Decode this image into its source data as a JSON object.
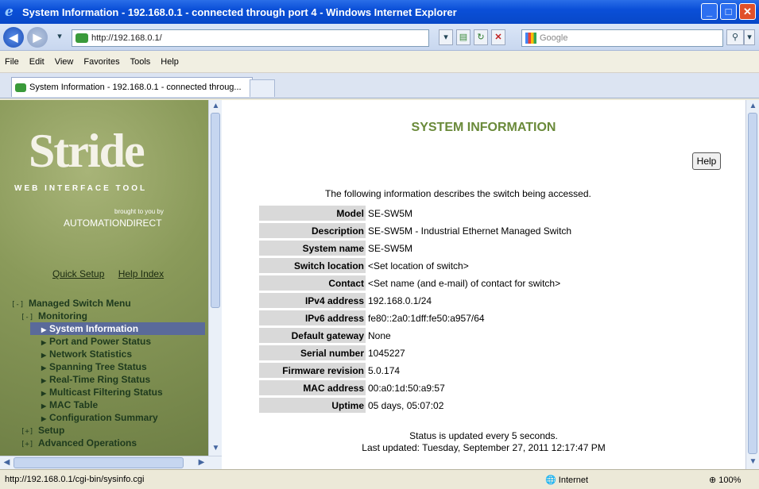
{
  "window": {
    "title": "System Information - 192.168.0.1 - connected through port 4 - Windows Internet Explorer",
    "min": "_",
    "max": "□",
    "close": "✕"
  },
  "address": {
    "url": "http://192.168.0.1/",
    "search_placeholder": "Google"
  },
  "menu": [
    "File",
    "Edit",
    "View",
    "Favorites",
    "Tools",
    "Help"
  ],
  "tab": {
    "label": "System Information - 192.168.0.1 - connected throug..."
  },
  "left": {
    "logo": "Stride",
    "logo_sub": "WEB INTERFACE TOOL",
    "brought": "brought to you by",
    "brand": "AUTOMATIONDIRECT",
    "links": [
      "Quick Setup",
      "Help Index"
    ],
    "tree": {
      "root_toggle": "[-]",
      "root": "Managed Switch Menu",
      "monitoring_toggle": "[-]",
      "monitoring": "Monitoring",
      "items": [
        "System Information",
        "Port and Power Status",
        "Network Statistics",
        "Spanning Tree Status",
        "Real-Time Ring Status",
        "Multicast Filtering Status",
        "MAC Table",
        "Configuration Summary"
      ],
      "setup_toggle": "[+]",
      "setup": "Setup",
      "adv_toggle": "[+]",
      "advanced": "Advanced Operations"
    }
  },
  "main": {
    "title": "SYSTEM INFORMATION",
    "help": "Help",
    "intro": "The following information describes the switch being accessed.",
    "rows": [
      {
        "k": "Model",
        "v": "SE-SW5M"
      },
      {
        "k": "Description",
        "v": "SE-SW5M - Industrial Ethernet Managed Switch"
      },
      {
        "k": "System name",
        "v": "SE-SW5M"
      },
      {
        "k": "Switch location",
        "v": "<Set location of switch>"
      },
      {
        "k": "Contact",
        "v": "<Set name (and e-mail) of contact for switch>"
      },
      {
        "k": "IPv4 address",
        "v": "192.168.0.1/24"
      },
      {
        "k": "IPv6 address",
        "v": "fe80::2a0:1dff:fe50:a957/64"
      },
      {
        "k": "Default gateway",
        "v": "None"
      },
      {
        "k": "Serial number",
        "v": "1045227"
      },
      {
        "k": "Firmware revision",
        "v": "5.0.174"
      },
      {
        "k": "MAC address",
        "v": "00:a0:1d:50:a9:57"
      },
      {
        "k": "Uptime",
        "v": "05 days, 05:07:02"
      }
    ],
    "status_update": "Status is updated every 5 seconds.",
    "last_updated": "Last updated: Tuesday, September 27, 2011 12:17:47 PM"
  },
  "statusbar": {
    "url": "http://192.168.0.1/cgi-bin/sysinfo.cgi",
    "zone": "Internet",
    "zoom": "100%"
  }
}
